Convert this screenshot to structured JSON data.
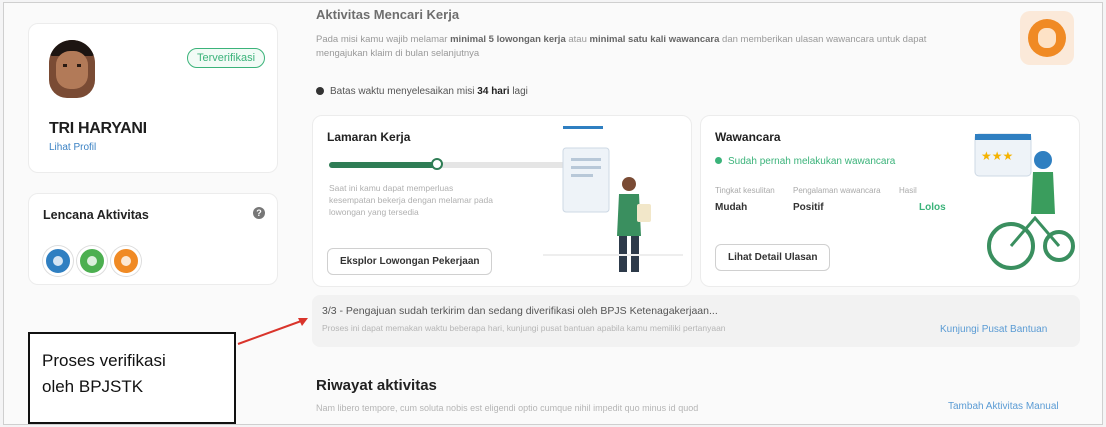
{
  "profile": {
    "verified_badge": "Terverifikasi",
    "name": "TRI HARYANI",
    "link": "Lihat Profil"
  },
  "badges": {
    "title": "Lencana Aktivitas",
    "help_icon": "?"
  },
  "mission": {
    "title": "Aktivitas Mencari Kerja",
    "desc_pre": "Pada misi kamu wajib melamar ",
    "desc_b1": "minimal 5 lowongan kerja",
    "desc_mid": " atau ",
    "desc_b2": "minimal satu kali wawancara",
    "desc_post": " dan memberikan ulasan wawancara untuk dapat mengajukan klaim di bulan selanjutnya",
    "deadline_pre": "Batas waktu menyelesaikan misi ",
    "deadline_bold": "34 hari",
    "deadline_post": " lagi"
  },
  "task_apply": {
    "title": "Lamaran Kerja",
    "progress": 0.45,
    "desc": "Saat ini kamu dapat memperluas kesempatan bekerja dengan melamar pada lowongan yang tersedia",
    "button": "Eksplor Lowongan Pekerjaan"
  },
  "task_interview": {
    "title": "Wawancara",
    "status": "Sudah pernah melakukan wawancara",
    "level_label": "Tingkat kesulitan",
    "level_value": "Mudah",
    "experience_label": "Pengalaman wawancara",
    "experience_value": "Positif",
    "result_label": "Hasil",
    "result_value": "Lolos",
    "button": "Lihat Detail Ulasan"
  },
  "notice": {
    "text": "3/3 - Pengajuan sudah terkirim dan sedang diverifikasi oleh BPJS Ketenagakerjaan...",
    "sub": "Proses ini dapat memakan waktu beberapa hari, kunjungi pusat bantuan apabila kamu memiliki pertanyaan",
    "link": "Kunjungi Pusat Bantuan"
  },
  "history": {
    "title": "Riwayat aktivitas",
    "desc": "Nam libero tempore, cum soluta nobis est eligendi optio cumque nihil impedit quo minus id quod",
    "link": "Tambah Aktivitas Manual"
  },
  "annotation": {
    "line1": "Proses verifikasi",
    "line2": "oleh BPJSTK"
  },
  "colors": {
    "accent_green": "#2f7d55",
    "verified_green": "#3bb37a",
    "link_blue": "#5a9bd4",
    "arrow_red": "#d9342b"
  }
}
